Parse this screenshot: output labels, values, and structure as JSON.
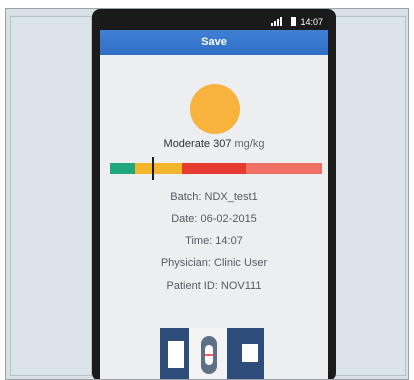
{
  "status_bar": {
    "time": "14:07"
  },
  "toolbar": {
    "save_label": "Save"
  },
  "result": {
    "level": "Moderate",
    "value": "307",
    "unit": "mg/kg"
  },
  "level_scale": {
    "segments": [
      "#1ea77c",
      "#f2b52b",
      "#e73b32",
      "#ef6f63"
    ],
    "marker_fraction": 0.2
  },
  "details": {
    "batch": "Batch: NDX_test1",
    "date": "Date: 06-02-2015",
    "time": "Time: 14:07",
    "physician": "Physician: Clinic User",
    "patient_id": "Patient ID: NOV111"
  },
  "colors": {
    "header_blue": "#2f6fc6",
    "moderate_orange": "#f8b23e",
    "cassette_navy": "#2e4d7b"
  },
  "icons": [
    "signal-icon",
    "battery-icon",
    "moderate-indicator-circle",
    "test-cassette-image"
  ]
}
